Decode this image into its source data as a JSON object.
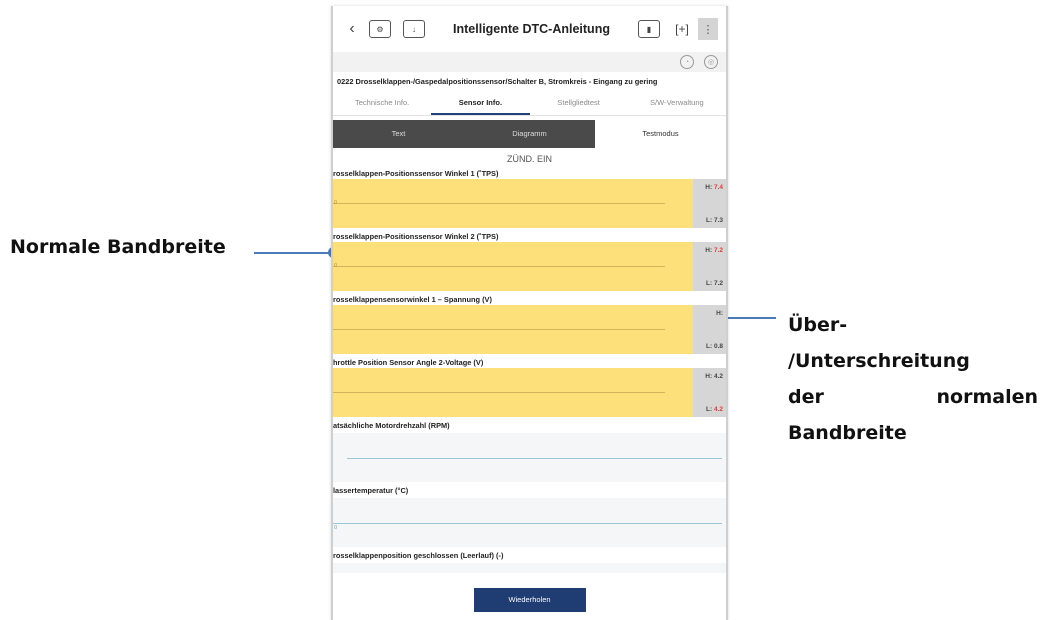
{
  "callouts": {
    "left": "Normale Bandbreite",
    "right_lines": [
      "Über-",
      "/Unterschreitung",
      "der",
      "normalen",
      "Bandbreite"
    ]
  },
  "colors": {
    "accent": "#1f3c73",
    "normal_band": "#fde07a",
    "callout_line": "#4a7ab8",
    "warning": "#e03b3b"
  },
  "app": {
    "title": "Intelligente DTC-Anleitung",
    "back_icon": "‹",
    "icons": [
      "engine-icon",
      "export-icon",
      "battery-icon",
      "plus-icon",
      "menu-icon"
    ]
  },
  "dtc_text": "0222 Drosselklappen-/Gaspedalpositionssensor/Schalter B, Stromkreis - Eingang zu gering",
  "tabs": [
    "Technische Info.",
    "Sensor Info.",
    "Stellgliedtest",
    "S/W-Verwaltung"
  ],
  "active_tab": "Sensor Info.",
  "modes": [
    "Text",
    "Diagramm",
    "Testmodus"
  ],
  "ignition": "ZÜND. EIN",
  "sensors": [
    {
      "label": "rosselklappen-Positionssensor Winkel 1 (˚TPS)",
      "high": "H: 7.4",
      "low": "L: 7.3",
      "zero": "0"
    },
    {
      "label": "rosselklappen-Positionssensor Winkel 2 (˚TPS)",
      "high": "H: 7.2",
      "low": "L: 7.2",
      "zero": "0"
    },
    {
      "label": "rosselklappensensorwinkel 1 – Spannung (V)",
      "high": "H:",
      "low": "L: 0.8"
    },
    {
      "label": "hrottle Position Sensor Angle 2-Voltage (V)",
      "high": "H: 4.2",
      "low": "L: 4.2"
    },
    {
      "label": "atsächliche Motordrehzahl (RPM)"
    },
    {
      "label": "lassertemperatur (°C)",
      "zero": "0"
    },
    {
      "label": "rosselklappenposition geschlossen (Leerlauf) (-)"
    }
  ],
  "repeat_button": "Wiederholen"
}
